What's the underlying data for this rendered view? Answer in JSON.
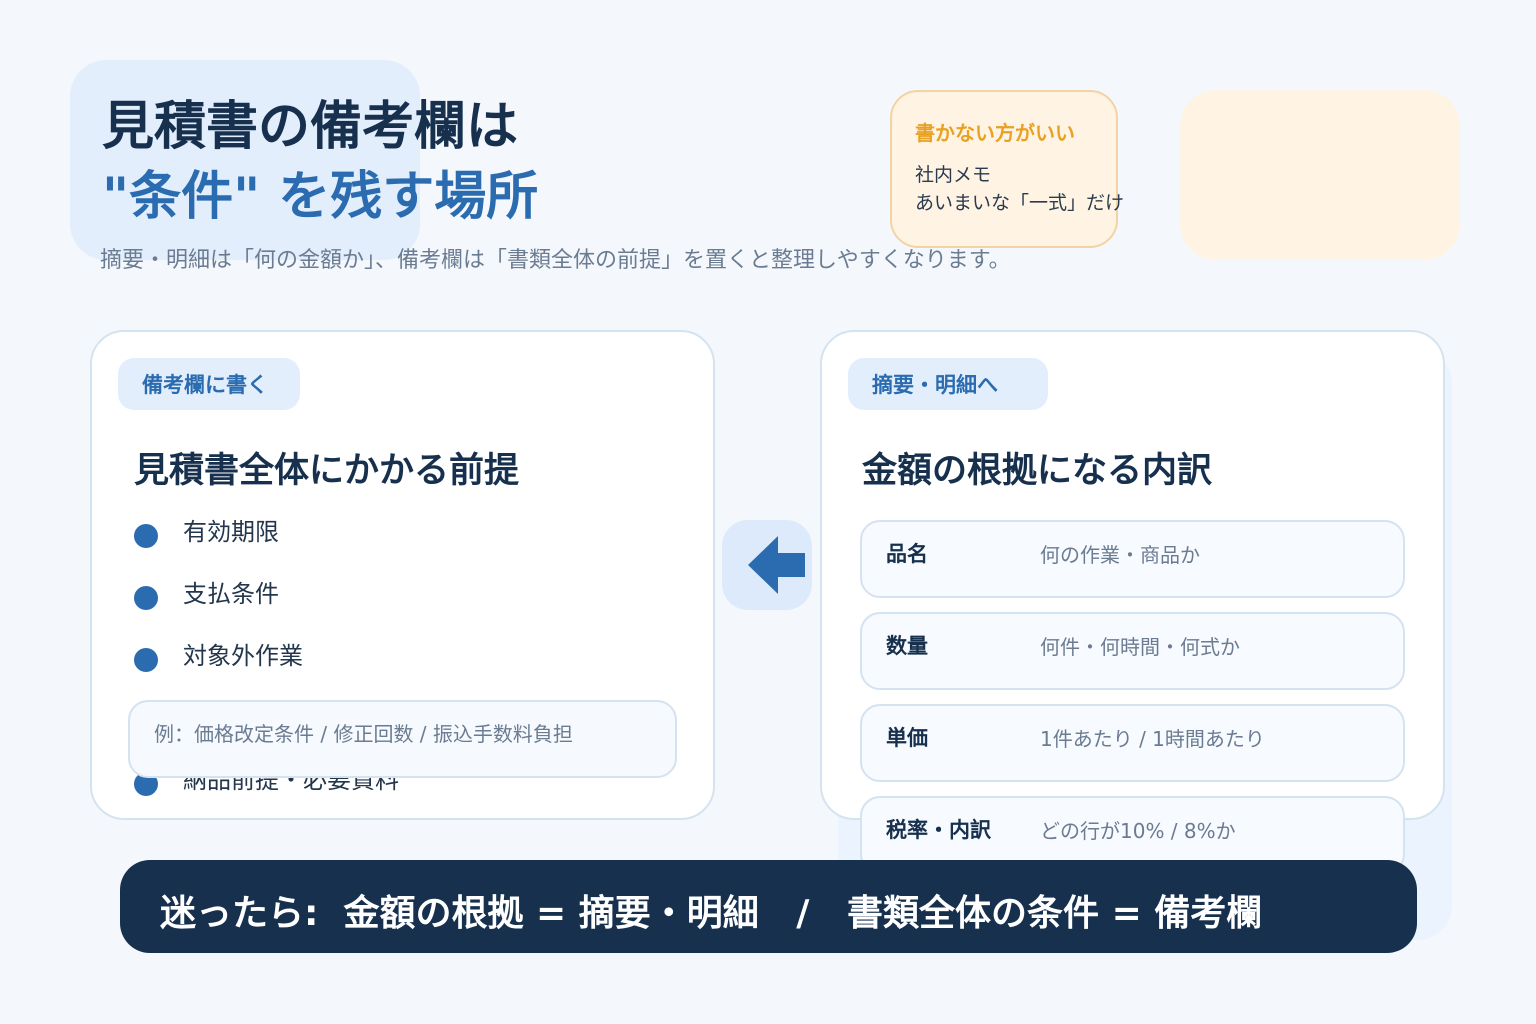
{
  "header": {
    "title_line1": "見積書の備考欄は",
    "title_line2": "\"条件\" を残す場所",
    "subtitle": "摘要・明細は「何の金額か」、備考欄は「書類全体の前提」を置くと整理しやすくなります。"
  },
  "note": {
    "title": "書かない方がいい",
    "lines": [
      "社内メモ",
      "あいまいな「一式」だけ"
    ]
  },
  "left_panel": {
    "chip": "備考欄に書く",
    "heading": "見積書全体にかかる前提",
    "items": [
      "有効期限",
      "支払条件",
      "対象外作業",
      "納品前提・必要資料"
    ],
    "example": "例：価格改定条件 / 修正回数 / 振込手数料負担"
  },
  "right_panel": {
    "chip": "摘要・明細へ",
    "heading": "金額の根拠になる内訳",
    "rows": [
      {
        "label": "品名",
        "value": "何の作業・商品か"
      },
      {
        "label": "数量",
        "value": "何件・何時間・何式か"
      },
      {
        "label": "単価",
        "value": "1件あたり / 1時間あたり"
      },
      {
        "label": "税率・内訳",
        "value": "どの行が10% / 8%か"
      }
    ]
  },
  "banner": {
    "text": "迷ったら:  金額の根拠 = 摘要・明細   /   書類全体の条件 = 備考欄"
  },
  "colors": {
    "navy": "#16304e",
    "accent_blue": "#2b6cb0",
    "note_orange": "#e8a122"
  },
  "icons": {
    "arrow": "arrow-left-icon",
    "bullet": "bullet-dot-icon"
  }
}
